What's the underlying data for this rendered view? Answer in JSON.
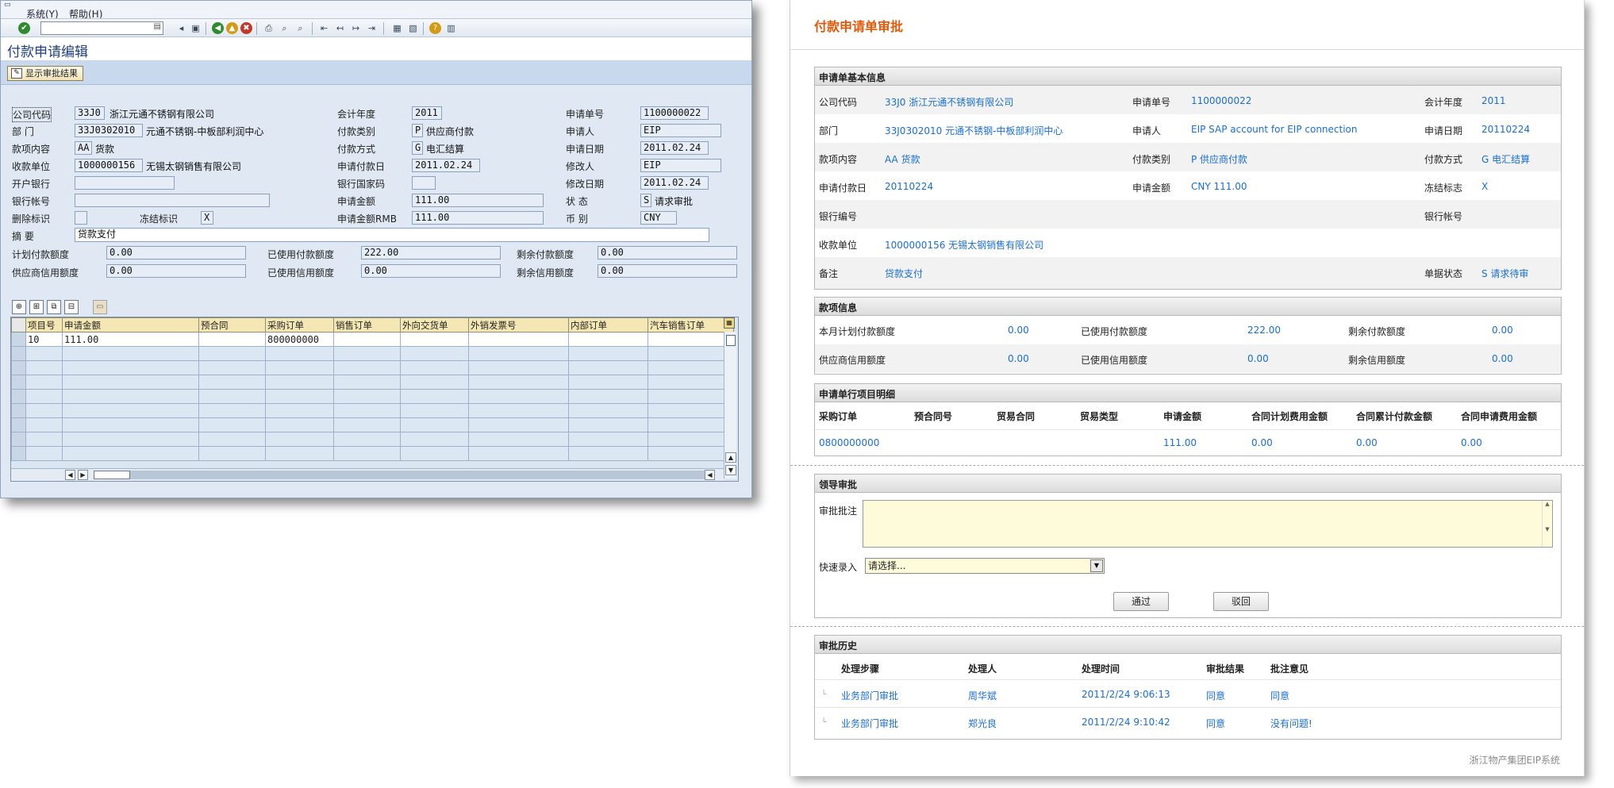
{
  "sap": {
    "menu": [
      "系统(Y)",
      "帮助(H)"
    ],
    "screen_title": "付款申请编辑",
    "show_result_button": "显示审批结果",
    "header": {
      "company_code": {
        "label": "公司代码",
        "value": "33J0",
        "text": "浙江元通不锈钢有限公司"
      },
      "department": {
        "label": "部 门",
        "value": "33J0302010",
        "text": "元通不锈钢-中板部利润中心"
      },
      "item_content": {
        "label": "款项内容",
        "value": "AA",
        "text": "货款"
      },
      "payee": {
        "label": "收款单位",
        "value": "1000000156",
        "text": "无锡太钢销售有限公司"
      },
      "bank": {
        "label": "开户银行",
        "value": ""
      },
      "bank_account": {
        "label": "银行帐号",
        "value": ""
      },
      "delete_flag": {
        "label": "删除标识",
        "value": ""
      },
      "freeze_flag": {
        "label": "冻结标识",
        "value": "X"
      },
      "summary": {
        "label": "摘 要",
        "value": "贷款支付"
      },
      "fiscal_year": {
        "label": "会计年度",
        "value": "2011"
      },
      "payment_type": {
        "label": "付款类别",
        "value": "P",
        "text": "供应商付款"
      },
      "payment_method": {
        "label": "付款方式",
        "value": "G",
        "text": "电汇结算"
      },
      "request_pay_date": {
        "label": "申请付款日",
        "value": "2011.02.24"
      },
      "bank_country": {
        "label": "银行国家码",
        "value": ""
      },
      "amount": {
        "label": "申请金额",
        "value": "111.00"
      },
      "amount_rmb": {
        "label": "申请金额RMB",
        "value": "111.00"
      },
      "request_no": {
        "label": "申请单号",
        "value": "1100000022"
      },
      "applicant": {
        "label": "申请人",
        "value": "EIP"
      },
      "request_date": {
        "label": "申请日期",
        "value": "2011.02.24"
      },
      "modifier": {
        "label": "修改人",
        "value": "EIP"
      },
      "modify_date": {
        "label": "修改日期",
        "value": "2011.02.24"
      },
      "status": {
        "label": "状 态",
        "value": "S",
        "text": "请求审批"
      },
      "currency": {
        "label": "币 别",
        "value": "CNY"
      }
    },
    "quota": {
      "plan_limit": {
        "label": "计划付款额度",
        "value": "0.00"
      },
      "used_pay": {
        "label": "已使用付款额度",
        "value": "222.00"
      },
      "remain_pay": {
        "label": "剩余付款额度",
        "value": "0.00"
      },
      "supplier_credit": {
        "label": "供应商信用额度",
        "value": "0.00"
      },
      "used_credit": {
        "label": "已使用信用额度",
        "value": "0.00"
      },
      "remain_credit": {
        "label": "剩余信用额度",
        "value": "0.00"
      }
    },
    "grid": {
      "columns": [
        "项目号",
        "申请金额",
        "预合同",
        "采购订单",
        "销售订单",
        "外向交货单",
        "外销发票号",
        "内部订单",
        "汽车销售订单"
      ],
      "rows": [
        [
          "10",
          "111.00",
          "",
          "800000000",
          "",
          "",
          "",
          "",
          ""
        ]
      ]
    }
  },
  "web": {
    "title": "付款申请单审批",
    "basic": {
      "heading": "申请单基本信息",
      "company_code": {
        "label": "公司代码",
        "value": "33J0   浙江元通不锈钢有限公司"
      },
      "request_no": {
        "label": "申请单号",
        "value": "1100000022"
      },
      "fiscal_year": {
        "label": "会计年度",
        "value": "2011"
      },
      "department": {
        "label": "部门",
        "value": "33J0302010   元通不锈钢-中板部利润中心"
      },
      "applicant": {
        "label": "申请人",
        "value": "EIP   SAP account for EIP connection"
      },
      "request_date": {
        "label": "申请日期",
        "value": "20110224"
      },
      "item_content": {
        "label": "款项内容",
        "value": "AA   货款"
      },
      "payment_type": {
        "label": "付款类别",
        "value": "P   供应商付款"
      },
      "payment_method": {
        "label": "付款方式",
        "value": "G   电汇结算"
      },
      "pay_date": {
        "label": "申请付款日",
        "value": "20110224"
      },
      "amount": {
        "label": "申请金额",
        "value": "CNY   111.00"
      },
      "freeze_flag": {
        "label": "冻结标志",
        "value": "X"
      },
      "bank_no": {
        "label": "银行编号",
        "value": ""
      },
      "bank_account": {
        "label": "银行帐号",
        "value": ""
      },
      "payee": {
        "label": "收款单位",
        "value": "1000000156   无锡太钢销售有限公司"
      },
      "remark": {
        "label": "备注",
        "value": "贷款支付"
      },
      "doc_status": {
        "label": "单据状态",
        "value": "S   请求待审"
      }
    },
    "funds": {
      "heading": "款项信息",
      "plan_month": {
        "label": "本月计划付款额度",
        "value": "0.00"
      },
      "used_pay": {
        "label": "已使用付款额度",
        "value": "222.00"
      },
      "remain_pay": {
        "label": "剩余付款额度",
        "value": "0.00"
      },
      "supplier_credit": {
        "label": "供应商信用额度",
        "value": "0.00"
      },
      "used_credit": {
        "label": "已使用信用额度",
        "value": "0.00"
      },
      "remain_credit": {
        "label": "剩余信用额度",
        "value": "0.00"
      }
    },
    "lines": {
      "heading": "申请单行项目明细",
      "columns": [
        "采购订单",
        "预合同号",
        "贸易合同",
        "贸易类型",
        "申请金额",
        "合同计划费用金额",
        "合同累计付款金额",
        "合同申请费用金额"
      ],
      "row": [
        "0800000000",
        "",
        "",
        "",
        "111.00",
        "0.00",
        "0.00",
        "0.00"
      ]
    },
    "approval": {
      "heading": "领导审批",
      "comment_label": "审批批注",
      "comment_value": "",
      "quick_label": "快速录入",
      "quick_value": "请选择...",
      "pass_button": "通过",
      "reject_button": "驳回"
    },
    "history": {
      "heading": "审批历史",
      "columns": [
        "处理步骤",
        "处理人",
        "处理时间",
        "审批结果",
        "批注意见"
      ],
      "rows": [
        [
          "业务部门审批",
          "周华斌",
          "2011/2/24 9:06:13",
          "同意",
          "同意"
        ],
        [
          "业务部门审批",
          "郑光良",
          "2011/2/24 9:10:42",
          "同意",
          "没有问题!"
        ]
      ]
    },
    "footer": "浙江物产集团EIP系统"
  }
}
